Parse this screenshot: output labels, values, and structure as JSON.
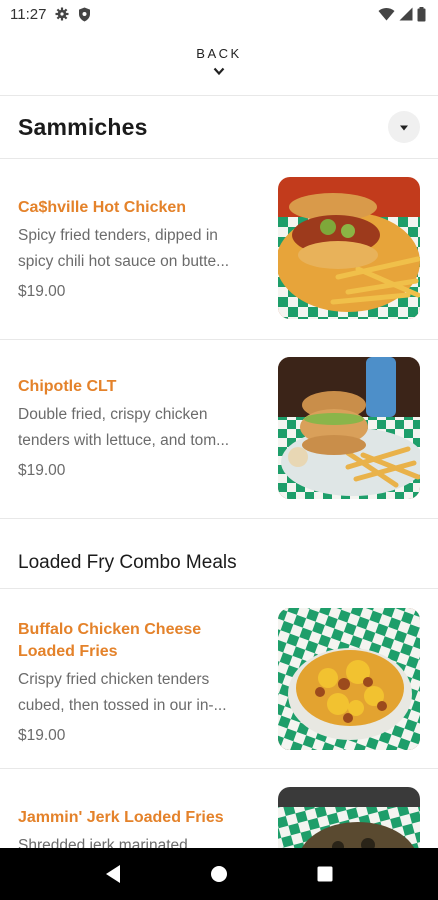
{
  "status_bar": {
    "time": "11:27",
    "icons": [
      "gear-icon",
      "shield-icon",
      "wifi-icon",
      "signal-icon",
      "battery-icon"
    ]
  },
  "back": {
    "label": "BACK"
  },
  "section": {
    "title": "Sammiches"
  },
  "items": [
    {
      "name": "Ca$hville Hot Chicken",
      "desc_line1": "Spicy fried tenders, dipped in",
      "desc_line2": "spicy chili hot sauce on butte...",
      "price": "$19.00"
    },
    {
      "name": "Chipotle CLT",
      "desc_line1": "Double fried, crispy chicken",
      "desc_line2": "tenders with lettuce, and tom...",
      "price": "$19.00"
    },
    {
      "name_line1": "Buffalo Chicken Cheese",
      "name_line2": "Loaded Fries",
      "desc_line1": "Crispy fried chicken tenders",
      "desc_line2": "cubed, then tossed in our in-...",
      "price": "$19.00"
    },
    {
      "name": "Jammin' Jerk Loaded Fries",
      "desc_line1": "Shredded jerk marinated"
    }
  ],
  "category": {
    "title": "Loaded Fry Combo Meals"
  },
  "colors": {
    "item_name": "#e4822a",
    "description": "#6b6b6b",
    "check_green": "#1e9e6a",
    "nav_bar": "#000000"
  },
  "nav": {
    "icons": [
      "back-triangle-icon",
      "home-circle-icon",
      "recents-square-icon"
    ]
  }
}
